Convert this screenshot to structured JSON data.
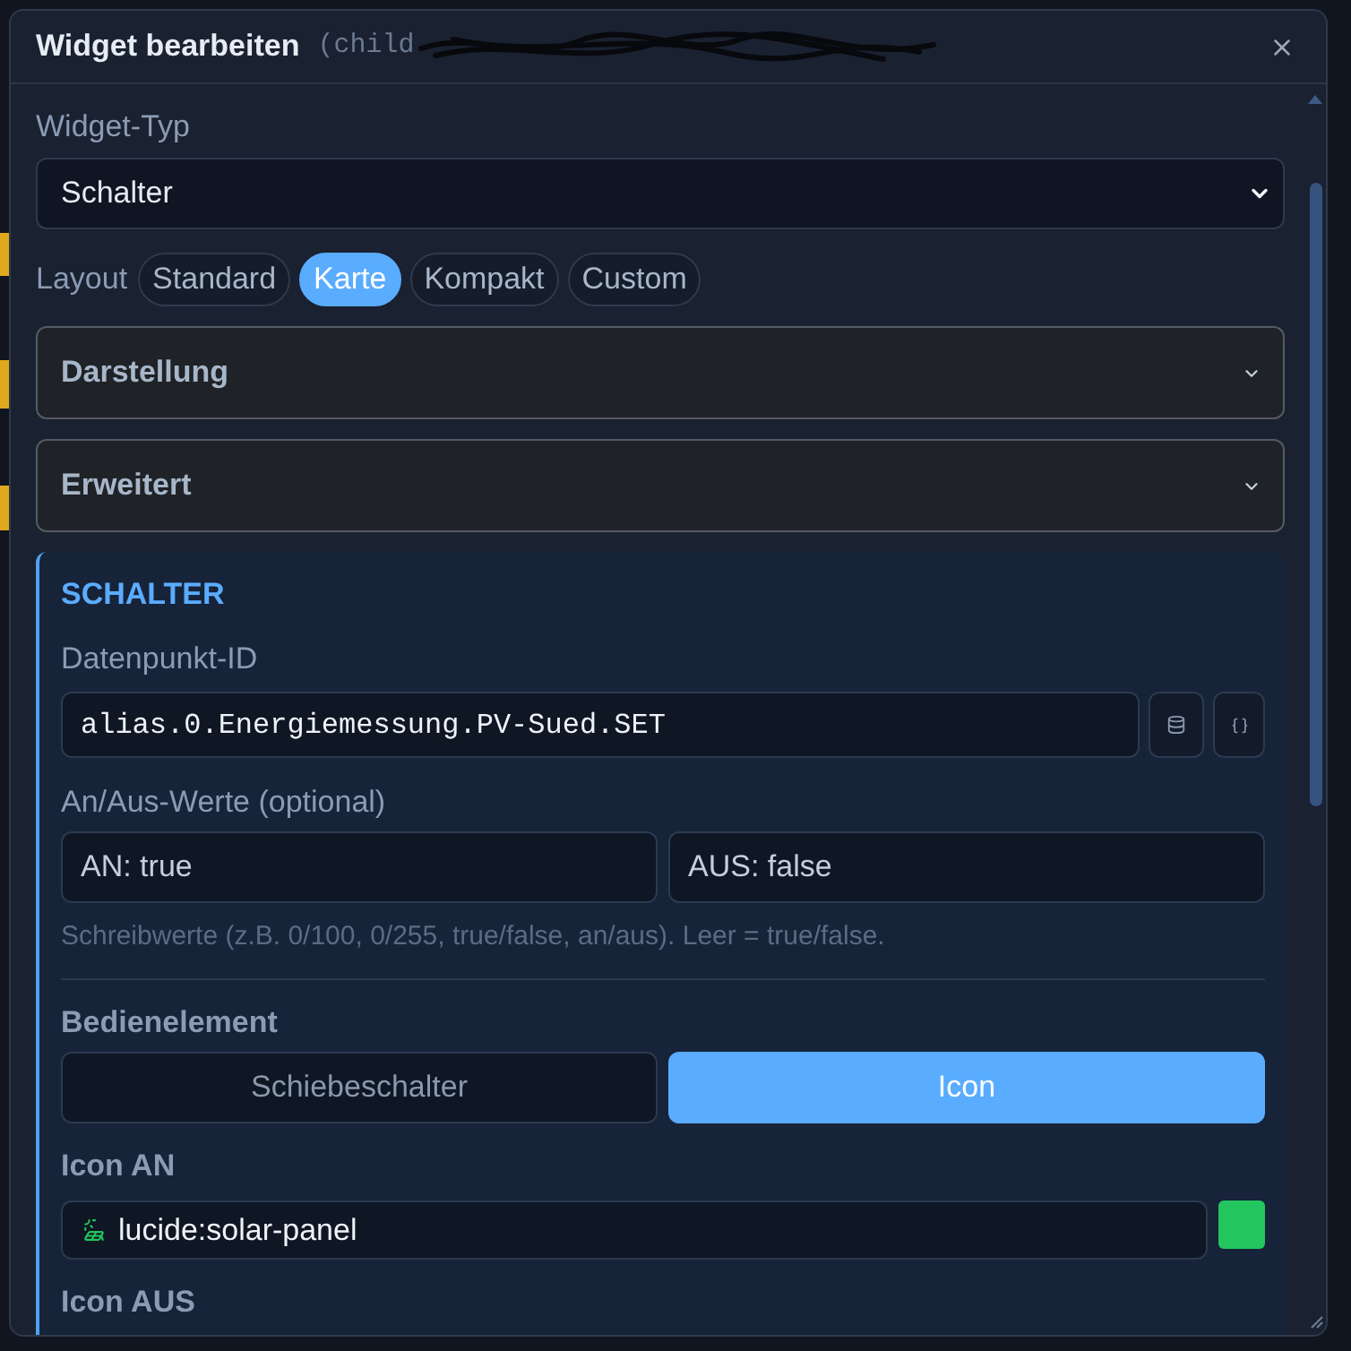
{
  "dialog": {
    "title": "Widget bearbeiten",
    "subtitle": "(child"
  },
  "widget_type": {
    "label": "Widget-Typ",
    "value": "Schalter"
  },
  "layout": {
    "label": "Layout",
    "options": [
      {
        "label": "Standard",
        "selected": false
      },
      {
        "label": "Karte",
        "selected": true
      },
      {
        "label": "Kompakt",
        "selected": false
      },
      {
        "label": "Custom",
        "selected": false
      }
    ]
  },
  "accordions": [
    {
      "label": "Darstellung",
      "expanded": false
    },
    {
      "label": "Erweitert",
      "expanded": false
    }
  ],
  "section": {
    "title": "SCHALTER",
    "datapoint": {
      "label": "Datenpunkt-ID",
      "value": "alias.0.Energiemessung.PV-Sued.SET"
    },
    "on_off": {
      "label": "An/Aus-Werte (optional)",
      "on": {
        "placeholder": "AN: true"
      },
      "off": {
        "placeholder": "AUS: false"
      },
      "hint": "Schreibwerte (z.B. 0/100, 0/255, true/false, an/aus). Leer = true/false."
    },
    "control": {
      "label": "Bedienelement",
      "options": [
        {
          "label": "Schiebeschalter",
          "selected": false
        },
        {
          "label": "Icon",
          "selected": true
        }
      ]
    },
    "icon_on": {
      "label": "Icon AN",
      "value": "lucide:solar-panel",
      "color": "#22c55e"
    },
    "icon_off": {
      "label": "Icon AUS"
    }
  }
}
